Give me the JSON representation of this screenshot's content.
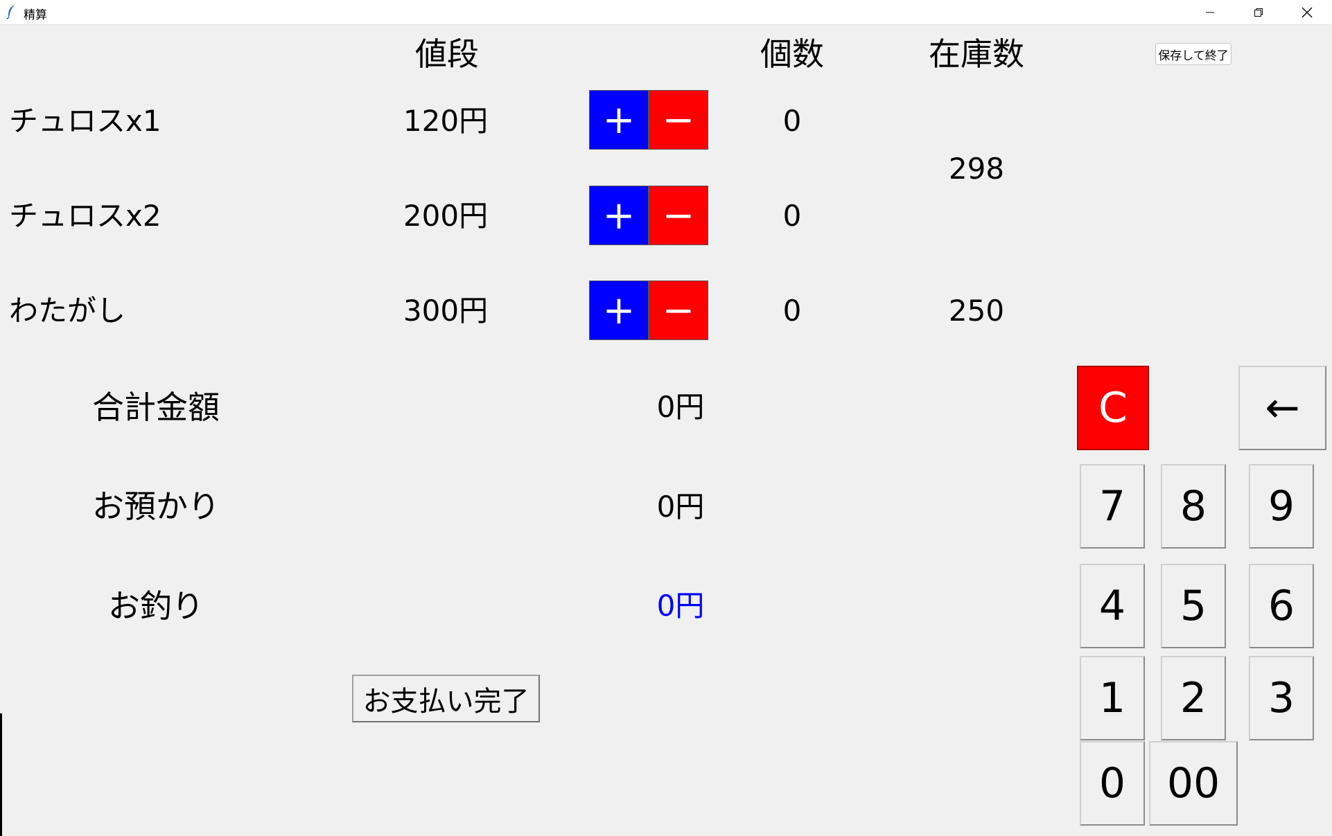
{
  "window": {
    "title": "精算"
  },
  "headers": {
    "price": "値段",
    "count": "個数",
    "stock": "在庫数"
  },
  "save_button": "保存して終了",
  "items": [
    {
      "name": "チュロスx1",
      "price": "120円",
      "count": "0",
      "plus": "+",
      "minus": "−"
    },
    {
      "name": "チュロスx2",
      "price": "200円",
      "count": "0",
      "plus": "+",
      "minus": "−"
    },
    {
      "name": "わたがし",
      "price": "300円",
      "count": "0",
      "plus": "+",
      "minus": "−"
    }
  ],
  "stock": {
    "churros": "298",
    "cotton_candy": "250"
  },
  "summary": {
    "total_label": "合計金額",
    "total_value": "0円",
    "received_label": "お預かり",
    "received_value": "0円",
    "change_label": "お釣り",
    "change_value": "0円"
  },
  "pay_button": "お支払い完了",
  "keypad": {
    "clear": "C",
    "backspace": "←",
    "k7": "7",
    "k8": "8",
    "k9": "9",
    "k4": "4",
    "k5": "5",
    "k6": "6",
    "k1": "1",
    "k2": "2",
    "k3": "3",
    "k0": "0",
    "k00": "00"
  },
  "colors": {
    "plus": "#0000ff",
    "minus": "#ff0000",
    "clear": "#ff0000",
    "change_text": "#0000ff"
  }
}
